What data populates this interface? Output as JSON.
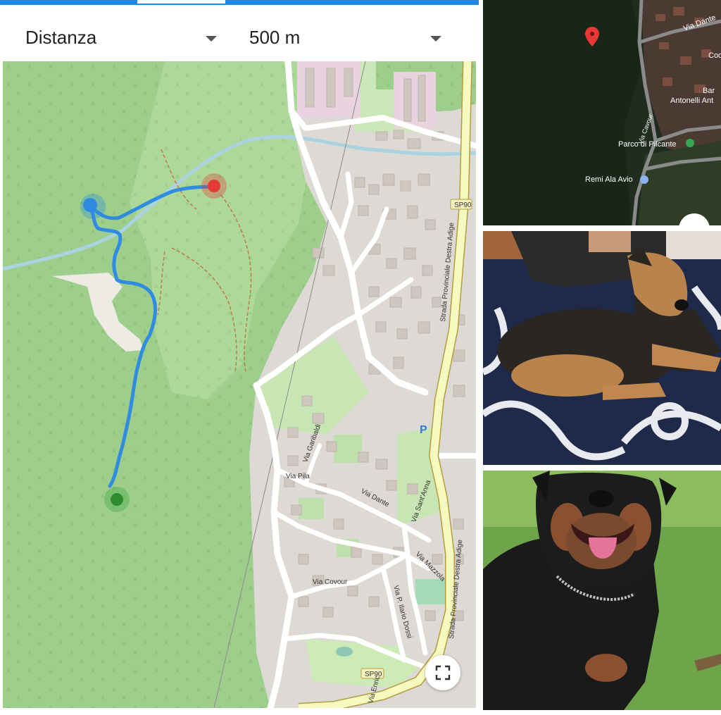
{
  "toolbar": {
    "metric_select": "Distanza",
    "value_select": "500 m"
  },
  "map": {
    "road_labels": {
      "sp90_top": "SP90",
      "sp90_bottom": "SP90",
      "strada_provinciale": "Strada Provinciale Destra Adige",
      "via_garibaldi": "Via Garibaldi",
      "via_pila": "Via Pila",
      "via_dante": "Via Dante",
      "via_sant_anna": "Via Sant'Anna",
      "via_mazzola": "Via Mazzola",
      "via_covour": "Via Covour",
      "via_ilario_dossi": "Via P. Ilario Dossi",
      "via_enrico": "Via Enric"
    },
    "parking_label": "P",
    "track_color": "#2f8ce0",
    "start_color": "#4caf50",
    "end_color": "#e53935",
    "fullscreen_icon": "fullscreen-icon"
  },
  "satellite": {
    "labels": {
      "via_dante": "Via Dante",
      "coo": "Coo",
      "bar": "Bar",
      "antonelli": "Antonelli Ant",
      "via_cavour": "Via Cavour",
      "parco": "Parco di Pilcante",
      "remi": "Remi Ala Avio"
    },
    "pin_color": "#e53935"
  },
  "photos": {
    "puppy": "puppy-on-rug-photo",
    "rottweiler": "rottweiler-on-grass-photo"
  }
}
